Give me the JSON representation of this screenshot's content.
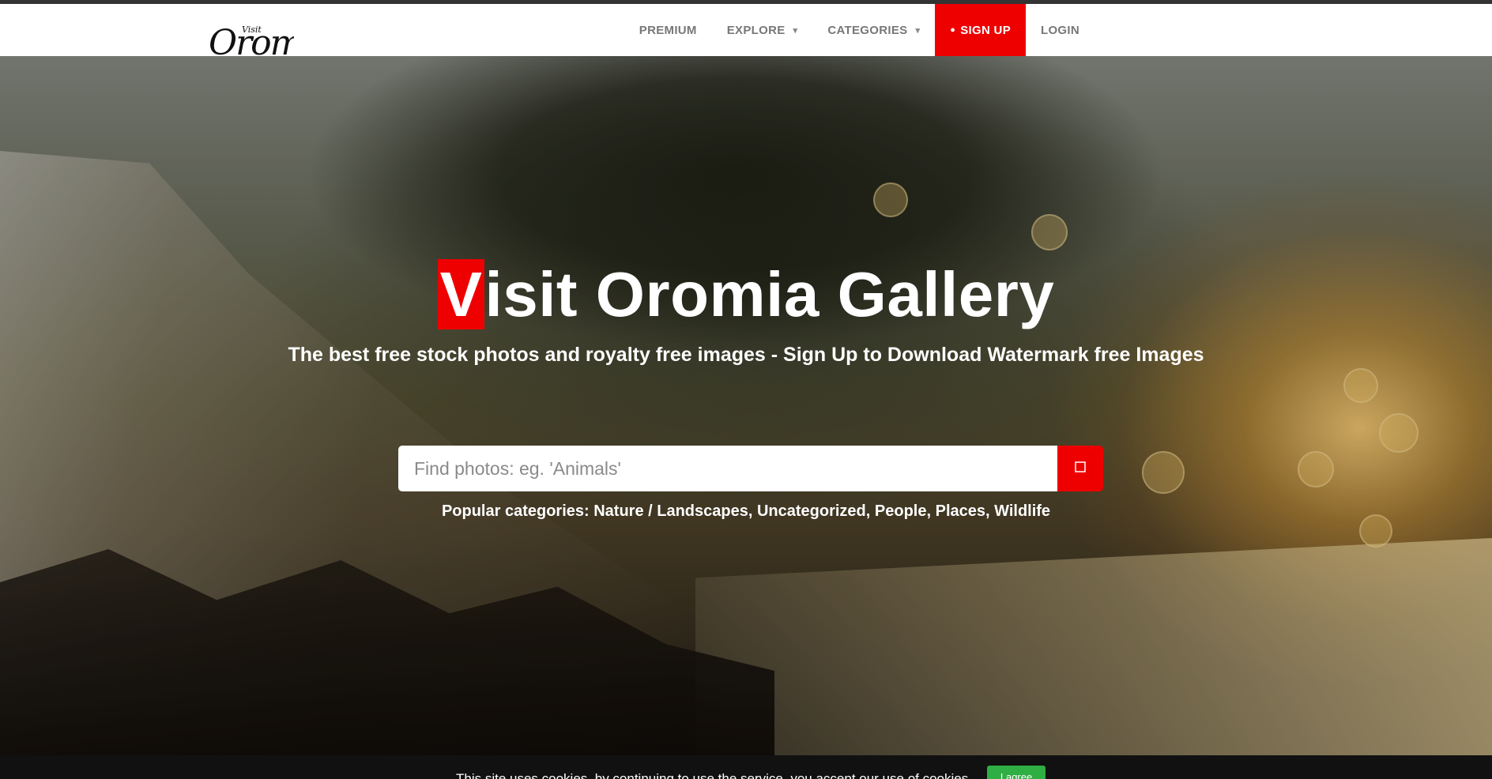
{
  "logo": {
    "small": "Visit",
    "big": "Oromia"
  },
  "nav": {
    "premium": "PREMIUM",
    "explore": "EXPLORE",
    "categories": "CATEGORIES",
    "signup": "SIGN UP",
    "login": "LOGIN"
  },
  "hero": {
    "title_first_letter": "V",
    "title_rest": "isit Oromia Gallery",
    "subtitle": "The best free stock photos and royalty free images - Sign Up to Download Watermark free Images"
  },
  "search": {
    "placeholder": "Find photos: eg. 'Animals'"
  },
  "popular": {
    "label": "Popular categories:",
    "items": [
      "Nature / Landscapes",
      "Uncategorized",
      "People",
      "Places",
      "Wildlife"
    ]
  },
  "cookie": {
    "text": "This site uses cookies, by continuing to use the service, you accept our use of cookies",
    "button": "I agree"
  },
  "colors": {
    "accent": "#ee0000",
    "navbar_bg": "#ffffff",
    "cookie_button": "#2fae43"
  },
  "icons": [
    "caret-down-icon",
    "user-plus-icon",
    "search-icon"
  ]
}
